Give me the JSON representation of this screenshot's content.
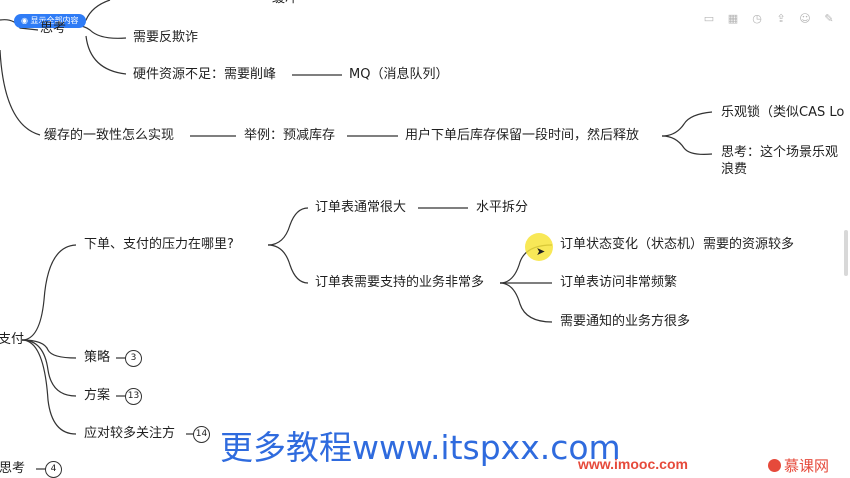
{
  "toolbar": {
    "expand_all_label": "显示全部内容",
    "icons": [
      "window-icon",
      "grid-icon",
      "clock-icon",
      "export-icon",
      "theme-icon",
      "pen-icon"
    ]
  },
  "nodes": {
    "top_partial": "缓冲",
    "think_partial": "思考",
    "anti_fraud": "需要反欺诈",
    "hardware": "硬件资源不足：需要削峰",
    "mq": "MQ（消息队列）",
    "cache_consistency": "缓存的一致性怎么实现",
    "example": "举例：预减库存",
    "hold_stock": "用户下单后库存保留一段时间，然后释放",
    "optimistic_lock": "乐观锁（类似CAS Lo",
    "think_scene_line1": "思考：这个场景乐观",
    "think_scene_line2": "浪费",
    "order_pressure": "下单、支付的压力在哪里?",
    "order_table_big": "订单表通常很大",
    "horizontal_split": "水平拆分",
    "order_table_business": "订单表需要支持的业务非常多",
    "state_change": "订单状态变化（状态机）需要的资源较多",
    "frequent_access": "订单表访问非常频繁",
    "notify_many": "需要通知的业务方很多",
    "pay_partial": "支付",
    "strategy": "策略",
    "plan": "方案",
    "focus_points": "应对较多关注方",
    "bottom_partial": "的思考"
  },
  "badges": {
    "strategy_count": "3",
    "plan_count": "13",
    "focus_count": "14",
    "bottom_count": "4"
  },
  "watermark": {
    "text": "更多教程www.itspxx.com",
    "imooc_url": "www.imooc.com",
    "imooc_brand": "慕课网"
  }
}
